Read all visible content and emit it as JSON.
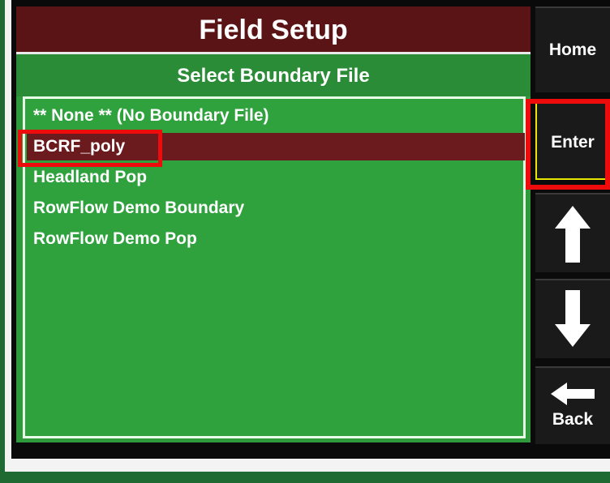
{
  "header": {
    "title": "Field Setup"
  },
  "subheader": {
    "title": "Select Boundary File"
  },
  "boundary_list": {
    "items": [
      {
        "label": "** None ** (No Boundary File)",
        "selected": false
      },
      {
        "label": "BCRF_poly",
        "selected": true
      },
      {
        "label": "Headland Pop",
        "selected": false
      },
      {
        "label": "RowFlow Demo Boundary",
        "selected": false
      },
      {
        "label": "RowFlow Demo Pop",
        "selected": false
      }
    ]
  },
  "sidebar": {
    "home_label": "Home",
    "enter_label": "Enter",
    "up_icon": "up-arrow-icon",
    "down_icon": "down-arrow-icon",
    "back_label": "Back",
    "back_icon": "left-arrow-icon"
  },
  "colors": {
    "title_bar": "#5a1416",
    "screen_green": "#2f9a3c",
    "selected_row": "#6b1a1d",
    "highlight_red": "#ee0b0b"
  }
}
